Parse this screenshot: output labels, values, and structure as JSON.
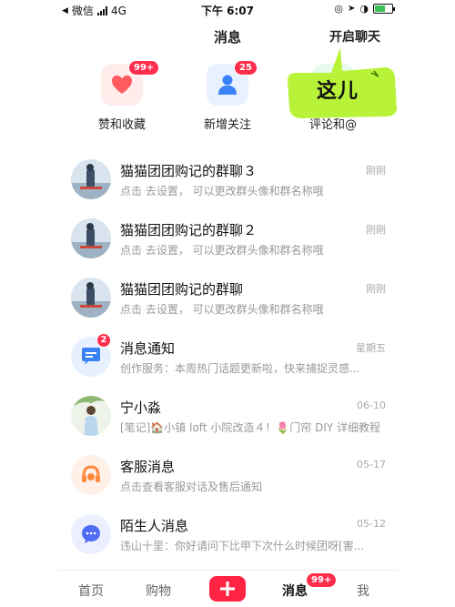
{
  "status_bar": {
    "carrier": "微信",
    "network": "4G",
    "time": "下午 6:07"
  },
  "header": {
    "title": "消息",
    "start_chat": "开启聊天"
  },
  "callout": {
    "text": "这儿",
    "color": "#b8f33a"
  },
  "quick_actions": [
    {
      "label": "赞和收藏",
      "badge": "99+",
      "icon": "heart-icon"
    },
    {
      "label": "新增关注",
      "badge": "25",
      "icon": "person-icon"
    },
    {
      "label": "评论和@",
      "badge": "",
      "icon": "comment-icon"
    }
  ],
  "conversations": [
    {
      "title": "猫猫团团购记的群聊３",
      "subtitle": "点击 去设置， 可以更改群头像和群名称哦",
      "time": "刚刚",
      "avatar": "group-avatar",
      "badge": ""
    },
    {
      "title": "猫猫团团购记的群聊２",
      "subtitle": "点击 去设置， 可以更改群头像和群名称哦",
      "time": "刚刚",
      "avatar": "group-avatar",
      "badge": ""
    },
    {
      "title": "猫猫团团购记的群聊",
      "subtitle": "点击 去设置， 可以更改群头像和群名称哦",
      "time": "刚刚",
      "avatar": "group-avatar",
      "badge": ""
    },
    {
      "title": "消息通知",
      "subtitle": "创作服务：本周热门话题更新啦，快来捕捉灵感...",
      "time": "星期五",
      "avatar": "notification-icon",
      "badge": "2"
    },
    {
      "title": "宁小淼",
      "subtitle": "[笔记]🏠小镇 loft 小院改造４！🌷门帘 DIY 详细教程",
      "time": "06-10",
      "avatar": "user-avatar",
      "badge": ""
    },
    {
      "title": "客服消息",
      "subtitle": "点击查看客服对话及售后通知",
      "time": "05-17",
      "avatar": "headset-icon",
      "badge": ""
    },
    {
      "title": "陌生人消息",
      "subtitle": "违山十里：你好请问下比甲下次什么时候团呀[害...",
      "time": "05-12",
      "avatar": "chat-bubble-icon",
      "badge": ""
    }
  ],
  "tab_bar": {
    "home": "首页",
    "shop": "购物",
    "messages": "消息",
    "messages_badge": "99+",
    "me": "我"
  },
  "colors": {
    "accent": "#ff2442",
    "badge": "#ff2e4d"
  }
}
